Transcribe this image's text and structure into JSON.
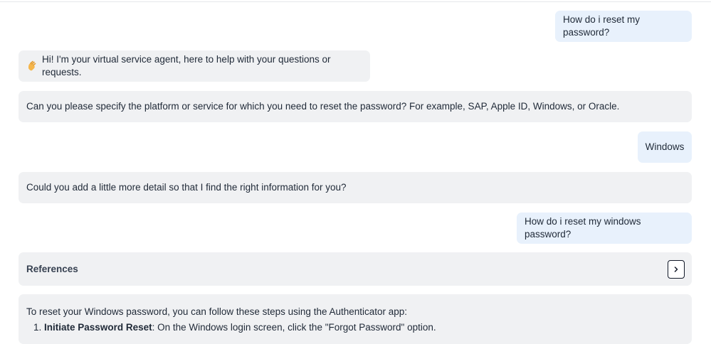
{
  "messages": {
    "user1": "How do i reset my password?",
    "bot_greeting": "Hi! I'm your virtual service agent, here to help with your questions or requests.",
    "bot_clarify": "Can you please specify the platform or service for which you need to reset the password? For example, SAP, Apple ID, Windows, or Oracle.",
    "user2": "Windows",
    "bot_more_detail": "Could you add a little more detail so that I find the right information for you?",
    "user3": "How do i reset my windows password?"
  },
  "references": {
    "label": "References",
    "icon": "chevron-right-icon"
  },
  "answer": {
    "intro": "To reset your Windows password, you can follow these steps using the Authenticator app:",
    "steps": [
      {
        "number": "1.",
        "title": "Initiate Password Reset",
        "text": ": On the Windows login screen, click the \"Forgot Password\" option."
      }
    ]
  },
  "colors": {
    "user_bubble": "#e8f1fc",
    "bot_bubble": "#f0f1f3"
  },
  "icons": {
    "greeting": "waving-hand-icon"
  }
}
